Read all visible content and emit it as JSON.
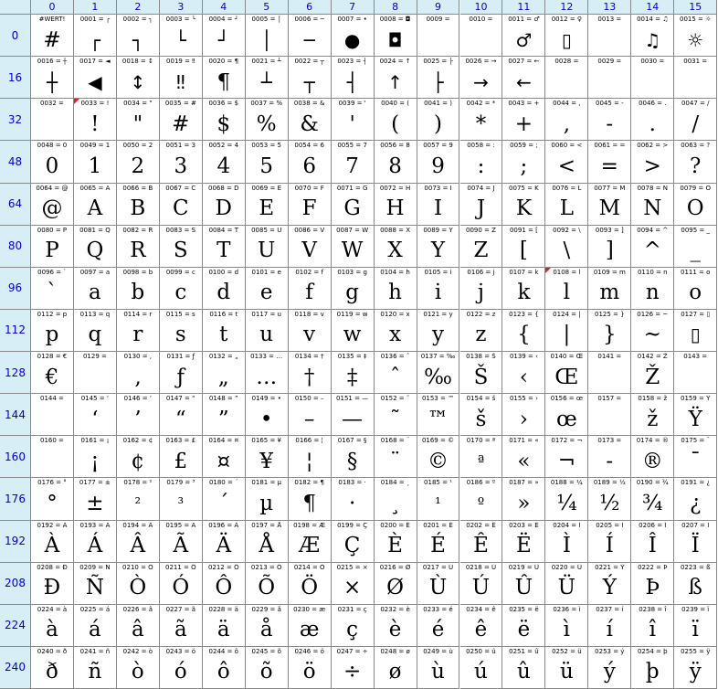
{
  "column_headers": [
    "0",
    "1",
    "2",
    "3",
    "4",
    "5",
    "6",
    "7",
    "8",
    "9",
    "10",
    "11",
    "12",
    "13",
    "14",
    "15"
  ],
  "row_headers": [
    "0",
    "16",
    "32",
    "48",
    "64",
    "80",
    "96",
    "112",
    "128",
    "144",
    "160",
    "176",
    "192",
    "208",
    "224",
    "240"
  ],
  "rows": [
    [
      {
        "code": "#WERT!",
        "glyph": "#"
      },
      {
        "code": "0001 = ┌",
        "glyph": "┌"
      },
      {
        "code": "0002 = ┐",
        "glyph": "┐"
      },
      {
        "code": "0003 = └",
        "glyph": "└"
      },
      {
        "code": "0004 = ┘",
        "glyph": "┘"
      },
      {
        "code": "0005 = │",
        "glyph": "│"
      },
      {
        "code": "0006 = ─",
        "glyph": "─"
      },
      {
        "code": "0007 = •",
        "glyph": "●"
      },
      {
        "code": "0008 = ◘",
        "glyph": "◘"
      },
      {
        "code": "0009 =",
        "glyph": ""
      },
      {
        "code": "0010 =",
        "glyph": ""
      },
      {
        "code": "0011 = ♂",
        "glyph": "♂"
      },
      {
        "code": "0012 = ♀",
        "glyph": "▯"
      },
      {
        "code": "0013 =",
        "glyph": ""
      },
      {
        "code": "0014 = ♫",
        "glyph": "♫"
      },
      {
        "code": "0015 = ☼",
        "glyph": "☼"
      }
    ],
    [
      {
        "code": "0016 = ┼",
        "glyph": "┼"
      },
      {
        "code": "0017 = ◄",
        "glyph": "◀"
      },
      {
        "code": "0018 = ↕",
        "glyph": "↕"
      },
      {
        "code": "0019 = ‼",
        "glyph": "‼"
      },
      {
        "code": "0020 = ¶",
        "glyph": "¶"
      },
      {
        "code": "0021 = ┴",
        "glyph": "┴"
      },
      {
        "code": "0022 = ┬",
        "glyph": "┬"
      },
      {
        "code": "0023 = ┤",
        "glyph": "┤"
      },
      {
        "code": "0024 = ↑",
        "glyph": "↑"
      },
      {
        "code": "0025 = ├",
        "glyph": "├"
      },
      {
        "code": "0026 = →",
        "glyph": "→"
      },
      {
        "code": "0027 = ←",
        "glyph": "←"
      },
      {
        "code": "0028 =",
        "glyph": ""
      },
      {
        "code": "0029 =",
        "glyph": ""
      },
      {
        "code": "0030 =",
        "glyph": ""
      },
      {
        "code": "0031 =",
        "glyph": ""
      }
    ],
    [
      {
        "code": "0032 =",
        "glyph": ""
      },
      {
        "code": "0033 = !",
        "glyph": "!",
        "flag": true
      },
      {
        "code": "0034 = \"",
        "glyph": "\""
      },
      {
        "code": "0035 = #",
        "glyph": "#"
      },
      {
        "code": "0036 = $",
        "glyph": "$"
      },
      {
        "code": "0037 = %",
        "glyph": "%"
      },
      {
        "code": "0038 = &",
        "glyph": "&"
      },
      {
        "code": "0039 = '",
        "glyph": "'"
      },
      {
        "code": "0040 = (",
        "glyph": "("
      },
      {
        "code": "0041 = )",
        "glyph": ")"
      },
      {
        "code": "0042 = *",
        "glyph": "*"
      },
      {
        "code": "0043 = +",
        "glyph": "+"
      },
      {
        "code": "0044 = ,",
        "glyph": ","
      },
      {
        "code": "0045 = -",
        "glyph": "-"
      },
      {
        "code": "0046 = .",
        "glyph": "."
      },
      {
        "code": "0047 = /",
        "glyph": "/"
      }
    ],
    [
      {
        "code": "0048 = 0",
        "glyph": "0"
      },
      {
        "code": "0049 = 1",
        "glyph": "1"
      },
      {
        "code": "0050 = 2",
        "glyph": "2"
      },
      {
        "code": "0051 = 3",
        "glyph": "3"
      },
      {
        "code": "0052 = 4",
        "glyph": "4"
      },
      {
        "code": "0053 = 5",
        "glyph": "5"
      },
      {
        "code": "0054 = 6",
        "glyph": "6"
      },
      {
        "code": "0055 = 7",
        "glyph": "7"
      },
      {
        "code": "0056 = 8",
        "glyph": "8"
      },
      {
        "code": "0057 = 9",
        "glyph": "9"
      },
      {
        "code": "0058 = :",
        "glyph": ":"
      },
      {
        "code": "0059 = ;",
        "glyph": ";"
      },
      {
        "code": "0060 = <",
        "glyph": "<"
      },
      {
        "code": "0061 = =",
        "glyph": "="
      },
      {
        "code": "0062 = >",
        "glyph": ">"
      },
      {
        "code": "0063 = ?",
        "glyph": "?"
      }
    ],
    [
      {
        "code": "0064 = @",
        "glyph": "@"
      },
      {
        "code": "0065 = A",
        "glyph": "A"
      },
      {
        "code": "0066 = B",
        "glyph": "B"
      },
      {
        "code": "0067 = C",
        "glyph": "C"
      },
      {
        "code": "0068 = D",
        "glyph": "D"
      },
      {
        "code": "0069 = E",
        "glyph": "E"
      },
      {
        "code": "0070 = F",
        "glyph": "F"
      },
      {
        "code": "0071 = G",
        "glyph": "G"
      },
      {
        "code": "0072 = H",
        "glyph": "H"
      },
      {
        "code": "0073 = I",
        "glyph": "I"
      },
      {
        "code": "0074 = J",
        "glyph": "J"
      },
      {
        "code": "0075 = K",
        "glyph": "K"
      },
      {
        "code": "0076 = L",
        "glyph": "L"
      },
      {
        "code": "0077 = M",
        "glyph": "M"
      },
      {
        "code": "0078 = N",
        "glyph": "N"
      },
      {
        "code": "0079 = O",
        "glyph": "O"
      }
    ],
    [
      {
        "code": "0080 = P",
        "glyph": "P"
      },
      {
        "code": "0081 = Q",
        "glyph": "Q"
      },
      {
        "code": "0082 = R",
        "glyph": "R"
      },
      {
        "code": "0083 = S",
        "glyph": "S"
      },
      {
        "code": "0084 = T",
        "glyph": "T"
      },
      {
        "code": "0085 = U",
        "glyph": "U"
      },
      {
        "code": "0086 = V",
        "glyph": "V"
      },
      {
        "code": "0087 = W",
        "glyph": "W"
      },
      {
        "code": "0088 = X",
        "glyph": "X"
      },
      {
        "code": "0089 = Y",
        "glyph": "Y"
      },
      {
        "code": "0090 = Z",
        "glyph": "Z"
      },
      {
        "code": "0091 = [",
        "glyph": "["
      },
      {
        "code": "0092 = \\",
        "glyph": "\\"
      },
      {
        "code": "0093 = ]",
        "glyph": "]"
      },
      {
        "code": "0094 = ^",
        "glyph": "^"
      },
      {
        "code": "0095 = _",
        "glyph": "_"
      }
    ],
    [
      {
        "code": "0096 = `",
        "glyph": "`"
      },
      {
        "code": "0097 = a",
        "glyph": "a"
      },
      {
        "code": "0098 = b",
        "glyph": "b"
      },
      {
        "code": "0099 = c",
        "glyph": "c"
      },
      {
        "code": "0100 = d",
        "glyph": "d"
      },
      {
        "code": "0101 = e",
        "glyph": "e"
      },
      {
        "code": "0102 = f",
        "glyph": "f"
      },
      {
        "code": "0103 = g",
        "glyph": "g"
      },
      {
        "code": "0104 = h",
        "glyph": "h"
      },
      {
        "code": "0105 = i",
        "glyph": "i"
      },
      {
        "code": "0106 = j",
        "glyph": "j"
      },
      {
        "code": "0107 = k",
        "glyph": "k"
      },
      {
        "code": "0108 = l",
        "glyph": "l",
        "flag": true
      },
      {
        "code": "0109 = m",
        "glyph": "m"
      },
      {
        "code": "0110 = n",
        "glyph": "n"
      },
      {
        "code": "0111 = o",
        "glyph": "o"
      }
    ],
    [
      {
        "code": "0112 = p",
        "glyph": "p"
      },
      {
        "code": "0113 = q",
        "glyph": "q"
      },
      {
        "code": "0114 = r",
        "glyph": "r"
      },
      {
        "code": "0115 = s",
        "glyph": "s"
      },
      {
        "code": "0116 = t",
        "glyph": "t"
      },
      {
        "code": "0117 = u",
        "glyph": "u"
      },
      {
        "code": "0118 = v",
        "glyph": "v"
      },
      {
        "code": "0119 = w",
        "glyph": "w"
      },
      {
        "code": "0120 = x",
        "glyph": "x"
      },
      {
        "code": "0121 = y",
        "glyph": "y"
      },
      {
        "code": "0122 = z",
        "glyph": "z"
      },
      {
        "code": "0123 = {",
        "glyph": "{"
      },
      {
        "code": "0124 = |",
        "glyph": "|"
      },
      {
        "code": "0125 = }",
        "glyph": "}"
      },
      {
        "code": "0126 = ~",
        "glyph": "~"
      },
      {
        "code": "0127 = ▯",
        "glyph": "▯"
      }
    ],
    [
      {
        "code": "0128 = €",
        "glyph": "€"
      },
      {
        "code": "0129 = ",
        "glyph": ""
      },
      {
        "code": "0130 = ‚",
        "glyph": "‚"
      },
      {
        "code": "0131 = ƒ",
        "glyph": "ƒ"
      },
      {
        "code": "0132 = „",
        "glyph": "„"
      },
      {
        "code": "0133 = …",
        "glyph": "…"
      },
      {
        "code": "0134 = †",
        "glyph": "†"
      },
      {
        "code": "0135 = ‡",
        "glyph": "‡"
      },
      {
        "code": "0136 = ˆ",
        "glyph": "ˆ"
      },
      {
        "code": "0137 = ‰",
        "glyph": "‰"
      },
      {
        "code": "0138 = Š",
        "glyph": "Š"
      },
      {
        "code": "0139 = ‹",
        "glyph": "‹"
      },
      {
        "code": "0140 = Œ",
        "glyph": "Œ"
      },
      {
        "code": "0141 = ",
        "glyph": ""
      },
      {
        "code": "0142 = Ž",
        "glyph": "Ž"
      },
      {
        "code": "0143 = ",
        "glyph": ""
      }
    ],
    [
      {
        "code": "0144 = ",
        "glyph": ""
      },
      {
        "code": "0145 = ‘",
        "glyph": "‘"
      },
      {
        "code": "0146 = ’",
        "glyph": "’"
      },
      {
        "code": "0147 = “",
        "glyph": "“"
      },
      {
        "code": "0148 = ”",
        "glyph": "”"
      },
      {
        "code": "0149 = •",
        "glyph": "•"
      },
      {
        "code": "0150 = –",
        "glyph": "–"
      },
      {
        "code": "0151 = —",
        "glyph": "—"
      },
      {
        "code": "0152 = ˜",
        "glyph": "˜"
      },
      {
        "code": "0153 = ™",
        "glyph": "™"
      },
      {
        "code": "0154 = š",
        "glyph": "š"
      },
      {
        "code": "0155 = ›",
        "glyph": "›"
      },
      {
        "code": "0156 = œ",
        "glyph": "œ"
      },
      {
        "code": "0157 = ",
        "glyph": ""
      },
      {
        "code": "0158 = ž",
        "glyph": "ž"
      },
      {
        "code": "0159 = Ÿ",
        "glyph": "Ÿ"
      }
    ],
    [
      {
        "code": "0160 = ",
        "glyph": ""
      },
      {
        "code": "0161 = ¡",
        "glyph": "¡"
      },
      {
        "code": "0162 = ¢",
        "glyph": "¢"
      },
      {
        "code": "0163 = £",
        "glyph": "£"
      },
      {
        "code": "0164 = ¤",
        "glyph": "¤"
      },
      {
        "code": "0165 = ¥",
        "glyph": "¥"
      },
      {
        "code": "0166 = ¦",
        "glyph": "¦"
      },
      {
        "code": "0167 = §",
        "glyph": "§"
      },
      {
        "code": "0168 = ¨",
        "glyph": "¨"
      },
      {
        "code": "0169 = ©",
        "glyph": "©"
      },
      {
        "code": "0170 = ª",
        "glyph": "ª"
      },
      {
        "code": "0171 = «",
        "glyph": "«"
      },
      {
        "code": "0172 = ¬",
        "glyph": "¬"
      },
      {
        "code": "0173 = ",
        "glyph": "-"
      },
      {
        "code": "0174 = ®",
        "glyph": "®"
      },
      {
        "code": "0175 = ¯",
        "glyph": "¯"
      }
    ],
    [
      {
        "code": "0176 = °",
        "glyph": "°"
      },
      {
        "code": "0177 = ±",
        "glyph": "±"
      },
      {
        "code": "0178 = ²",
        "glyph": "²"
      },
      {
        "code": "0179 = ³",
        "glyph": "³"
      },
      {
        "code": "0180 = ´",
        "glyph": "´"
      },
      {
        "code": "0181 = µ",
        "glyph": "µ"
      },
      {
        "code": "0182 = ¶",
        "glyph": "¶"
      },
      {
        "code": "0183 = ·",
        "glyph": "·"
      },
      {
        "code": "0184 = ¸",
        "glyph": "¸"
      },
      {
        "code": "0185 = ¹",
        "glyph": "¹"
      },
      {
        "code": "0186 = º",
        "glyph": "º"
      },
      {
        "code": "0187 = »",
        "glyph": "»"
      },
      {
        "code": "0188 = ¼",
        "glyph": "¼"
      },
      {
        "code": "0189 = ½",
        "glyph": "½"
      },
      {
        "code": "0190 = ¾",
        "glyph": "¾"
      },
      {
        "code": "0191 = ¿",
        "glyph": "¿"
      }
    ],
    [
      {
        "code": "0192 = À",
        "glyph": "À"
      },
      {
        "code": "0193 = Á",
        "glyph": "Á"
      },
      {
        "code": "0194 = Â",
        "glyph": "Â"
      },
      {
        "code": "0195 = Ã",
        "glyph": "Ã"
      },
      {
        "code": "0196 = Ä",
        "glyph": "Ä"
      },
      {
        "code": "0197 = Å",
        "glyph": "Å"
      },
      {
        "code": "0198 = Æ",
        "glyph": "Æ"
      },
      {
        "code": "0199 = Ç",
        "glyph": "Ç"
      },
      {
        "code": "0200 = È",
        "glyph": "È"
      },
      {
        "code": "0201 = É",
        "glyph": "É"
      },
      {
        "code": "0202 = Ê",
        "glyph": "Ê"
      },
      {
        "code": "0203 = Ë",
        "glyph": "Ë"
      },
      {
        "code": "0204 = Ì",
        "glyph": "Ì"
      },
      {
        "code": "0205 = Í",
        "glyph": "Í"
      },
      {
        "code": "0206 = Î",
        "glyph": "Î"
      },
      {
        "code": "0207 = Ï",
        "glyph": "Ï"
      }
    ],
    [
      {
        "code": "0208 = Ð",
        "glyph": "Ð"
      },
      {
        "code": "0209 = Ñ",
        "glyph": "Ñ"
      },
      {
        "code": "0210 = Ò",
        "glyph": "Ò"
      },
      {
        "code": "0211 = Ó",
        "glyph": "Ó"
      },
      {
        "code": "0212 = Ô",
        "glyph": "Ô"
      },
      {
        "code": "0213 = Õ",
        "glyph": "Õ"
      },
      {
        "code": "0214 = Ö",
        "glyph": "Ö"
      },
      {
        "code": "0215 = ×",
        "glyph": "×"
      },
      {
        "code": "0216 = Ø",
        "glyph": "Ø"
      },
      {
        "code": "0217 = Ù",
        "glyph": "Ù"
      },
      {
        "code": "0218 = Ú",
        "glyph": "Ú"
      },
      {
        "code": "0219 = Û",
        "glyph": "Û"
      },
      {
        "code": "0220 = Ü",
        "glyph": "Ü"
      },
      {
        "code": "0221 = Ý",
        "glyph": "Ý"
      },
      {
        "code": "0222 = Þ",
        "glyph": "Þ"
      },
      {
        "code": "0223 = ß",
        "glyph": "ß"
      }
    ],
    [
      {
        "code": "0224 = à",
        "glyph": "à"
      },
      {
        "code": "0225 = á",
        "glyph": "á"
      },
      {
        "code": "0226 = â",
        "glyph": "â"
      },
      {
        "code": "0227 = ã",
        "glyph": "ã"
      },
      {
        "code": "0228 = ä",
        "glyph": "ä"
      },
      {
        "code": "0229 = å",
        "glyph": "å"
      },
      {
        "code": "0230 = æ",
        "glyph": "æ"
      },
      {
        "code": "0231 = ç",
        "glyph": "ç"
      },
      {
        "code": "0232 = è",
        "glyph": "è"
      },
      {
        "code": "0233 = é",
        "glyph": "é"
      },
      {
        "code": "0234 = ê",
        "glyph": "ê"
      },
      {
        "code": "0235 = ë",
        "glyph": "ë"
      },
      {
        "code": "0236 = ì",
        "glyph": "ì"
      },
      {
        "code": "0237 = í",
        "glyph": "í"
      },
      {
        "code": "0238 = î",
        "glyph": "î"
      },
      {
        "code": "0239 = ï",
        "glyph": "ï"
      }
    ],
    [
      {
        "code": "0240 = ð",
        "glyph": "ð"
      },
      {
        "code": "0241 = ñ",
        "glyph": "ñ"
      },
      {
        "code": "0242 = ò",
        "glyph": "ò"
      },
      {
        "code": "0243 = ó",
        "glyph": "ó"
      },
      {
        "code": "0244 = ô",
        "glyph": "ô"
      },
      {
        "code": "0245 = õ",
        "glyph": "õ"
      },
      {
        "code": "0246 = ö",
        "glyph": "ö"
      },
      {
        "code": "0247 = ÷",
        "glyph": "÷"
      },
      {
        "code": "0248 = ø",
        "glyph": "ø"
      },
      {
        "code": "0249 = ù",
        "glyph": "ù"
      },
      {
        "code": "0250 = ú",
        "glyph": "ú"
      },
      {
        "code": "0251 = û",
        "glyph": "û"
      },
      {
        "code": "0252 = ü",
        "glyph": "ü"
      },
      {
        "code": "0253 = ý",
        "glyph": "ý"
      },
      {
        "code": "0254 = þ",
        "glyph": "þ"
      },
      {
        "code": "0255 = ÿ",
        "glyph": "ÿ"
      }
    ]
  ],
  "colors": {
    "header_bg": "#d7eef6",
    "header_text": "#0000cc",
    "grid_line": "#8a8a8a",
    "flag": "#e02020"
  }
}
